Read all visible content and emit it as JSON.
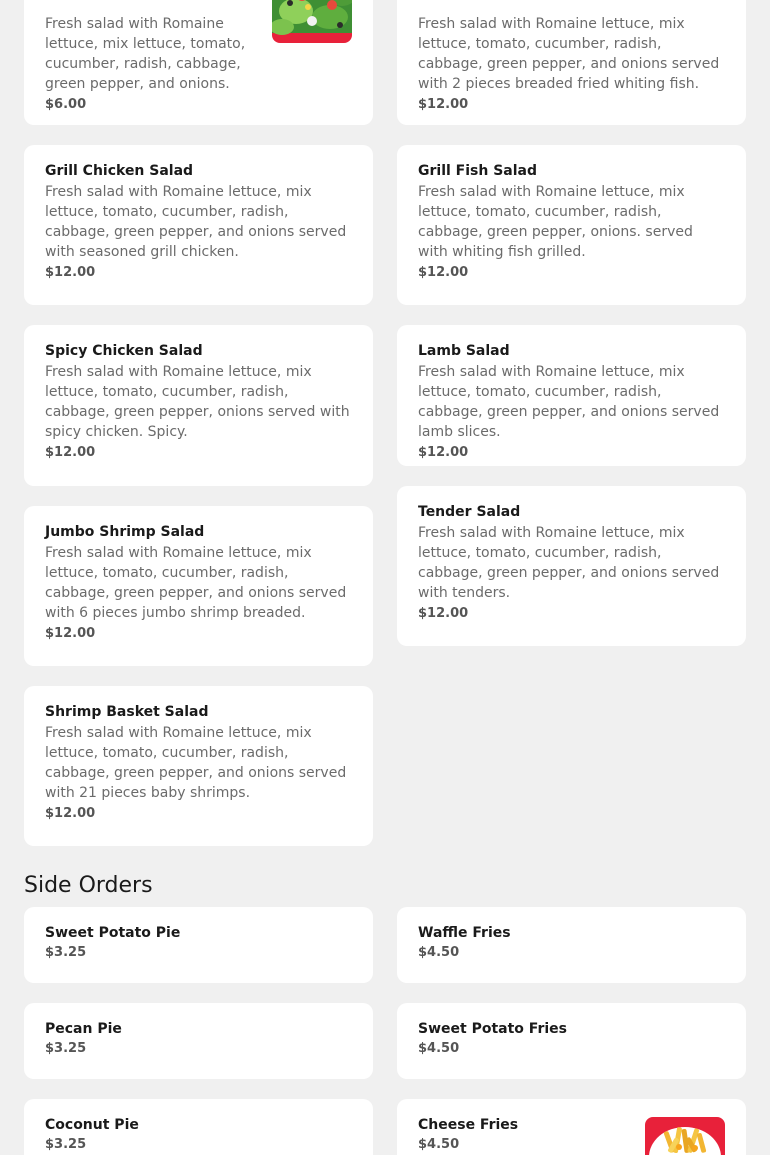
{
  "salads": [
    {
      "name": "",
      "description": "Fresh salad with Romaine lettuce, mix lettuce, tomato, cucumber, radish, cabbage, green pepper, and onions.",
      "price": "$6.00"
    },
    {
      "name": "",
      "description": "Fresh salad with Romaine lettuce, mix lettuce, tomato, cucumber, radish, cabbage, green pepper, and onions served with 2 pieces breaded fried whiting fish.",
      "price": "$12.00"
    },
    {
      "name": "Grill Chicken Salad",
      "description": "Fresh salad with Romaine lettuce, mix lettuce, tomato, cucumber, radish, cabbage, green pepper, and onions served with seasoned grill chicken.",
      "price": "$12.00"
    },
    {
      "name": "Grill Fish Salad",
      "description": "Fresh salad with Romaine lettuce, mix lettuce, tomato, cucumber, radish, cabbage, green pepper, onions. served with whiting fish grilled.",
      "price": "$12.00"
    },
    {
      "name": "Spicy Chicken Salad",
      "description": "Fresh salad with Romaine lettuce, mix lettuce, tomato, cucumber, radish, cabbage, green pepper, onions served with spicy chicken. Spicy.",
      "price": "$12.00"
    },
    {
      "name": "Lamb Salad",
      "description": "Fresh salad with Romaine lettuce, mix lettuce, tomato, cucumber, radish, cabbage, green pepper, and onions served lamb slices.",
      "price": "$12.00"
    },
    {
      "name": "Jumbo Shrimp Salad",
      "description": "Fresh salad with Romaine lettuce, mix lettuce, tomato, cucumber, radish, cabbage, green pepper, and onions served with 6 pieces jumbo shrimp breaded.",
      "price": "$12.00"
    },
    {
      "name": "Tender Salad",
      "description": "Fresh salad with Romaine lettuce, mix lettuce, tomato, cucumber, radish, cabbage, green pepper, and onions served with tenders.",
      "price": "$12.00"
    },
    {
      "name": "Shrimp Basket Salad",
      "description": "Fresh salad with Romaine lettuce, mix lettuce, tomato, cucumber, radish, cabbage, green pepper, and onions served with 21 pieces baby shrimps.",
      "price": "$12.00"
    }
  ],
  "side_orders": {
    "title": "Side Orders",
    "items": [
      {
        "name": "Sweet Potato Pie",
        "price": "$3.25"
      },
      {
        "name": "Waffle Fries",
        "price": "$4.50"
      },
      {
        "name": "Pecan Pie",
        "price": "$3.25"
      },
      {
        "name": "Sweet Potato Fries",
        "price": "$4.50"
      },
      {
        "name": "Coconut Pie",
        "price": "$3.25"
      },
      {
        "name": "Cheese Fries",
        "price": "$4.50"
      }
    ]
  },
  "thumbnails": {
    "salad": "salad-photo",
    "fries": "cheese-fries-photo"
  },
  "colors": {
    "background": "#f0f0f0",
    "card": "#ffffff",
    "price": "#555555",
    "description": "#6b6b6b",
    "thumb_accent": "#e8213a"
  }
}
